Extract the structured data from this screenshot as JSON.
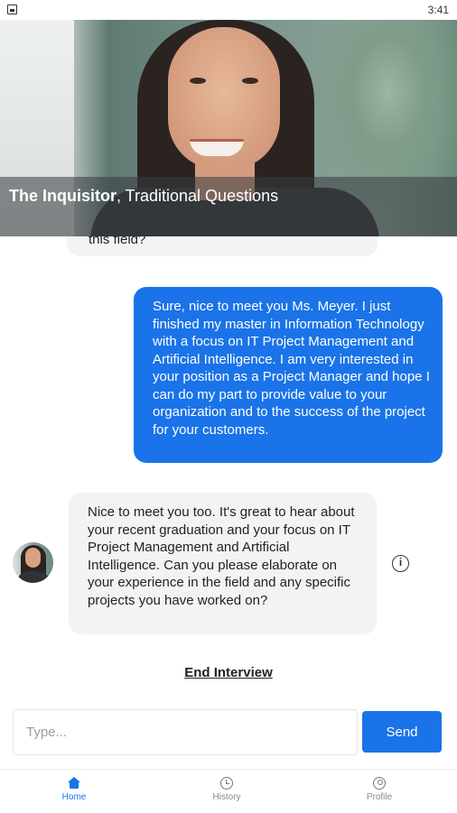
{
  "status_bar": {
    "time": "3:41"
  },
  "hero": {
    "persona_name": "The Inquisitor",
    "persona_style": ", Traditional Questions"
  },
  "chat": {
    "messages": [
      {
        "role": "interviewer",
        "text": "this field?"
      },
      {
        "role": "user",
        "text": "Sure, nice to meet you Ms. Meyer. I just finished my master in Information Technology with a focus on IT Project Management and Artificial Intelligence. I am very interested in your position as a Project Manager and hope I can do my part to provide value to your organization and to the success of the project for your customers."
      },
      {
        "role": "interviewer",
        "text": "Nice to meet you too. It's great to hear about your recent graduation and your focus on IT Project Management and Artificial Intelligence. Can you please elaborate on your experience in the field and any specific projects you have worked on?"
      }
    ],
    "end_interview_label": "End Interview"
  },
  "composer": {
    "placeholder": "Type...",
    "send_label": "Send"
  },
  "nav": {
    "items": [
      {
        "label": "Home",
        "icon": "home-icon",
        "active": true
      },
      {
        "label": "History",
        "icon": "clock-icon",
        "active": false
      },
      {
        "label": "Profile",
        "icon": "person-icon",
        "active": false
      }
    ]
  },
  "colors": {
    "accent": "#1a73e8",
    "bot_bubble": "#f1f3f5",
    "user_bubble_text": "#ffffff"
  }
}
